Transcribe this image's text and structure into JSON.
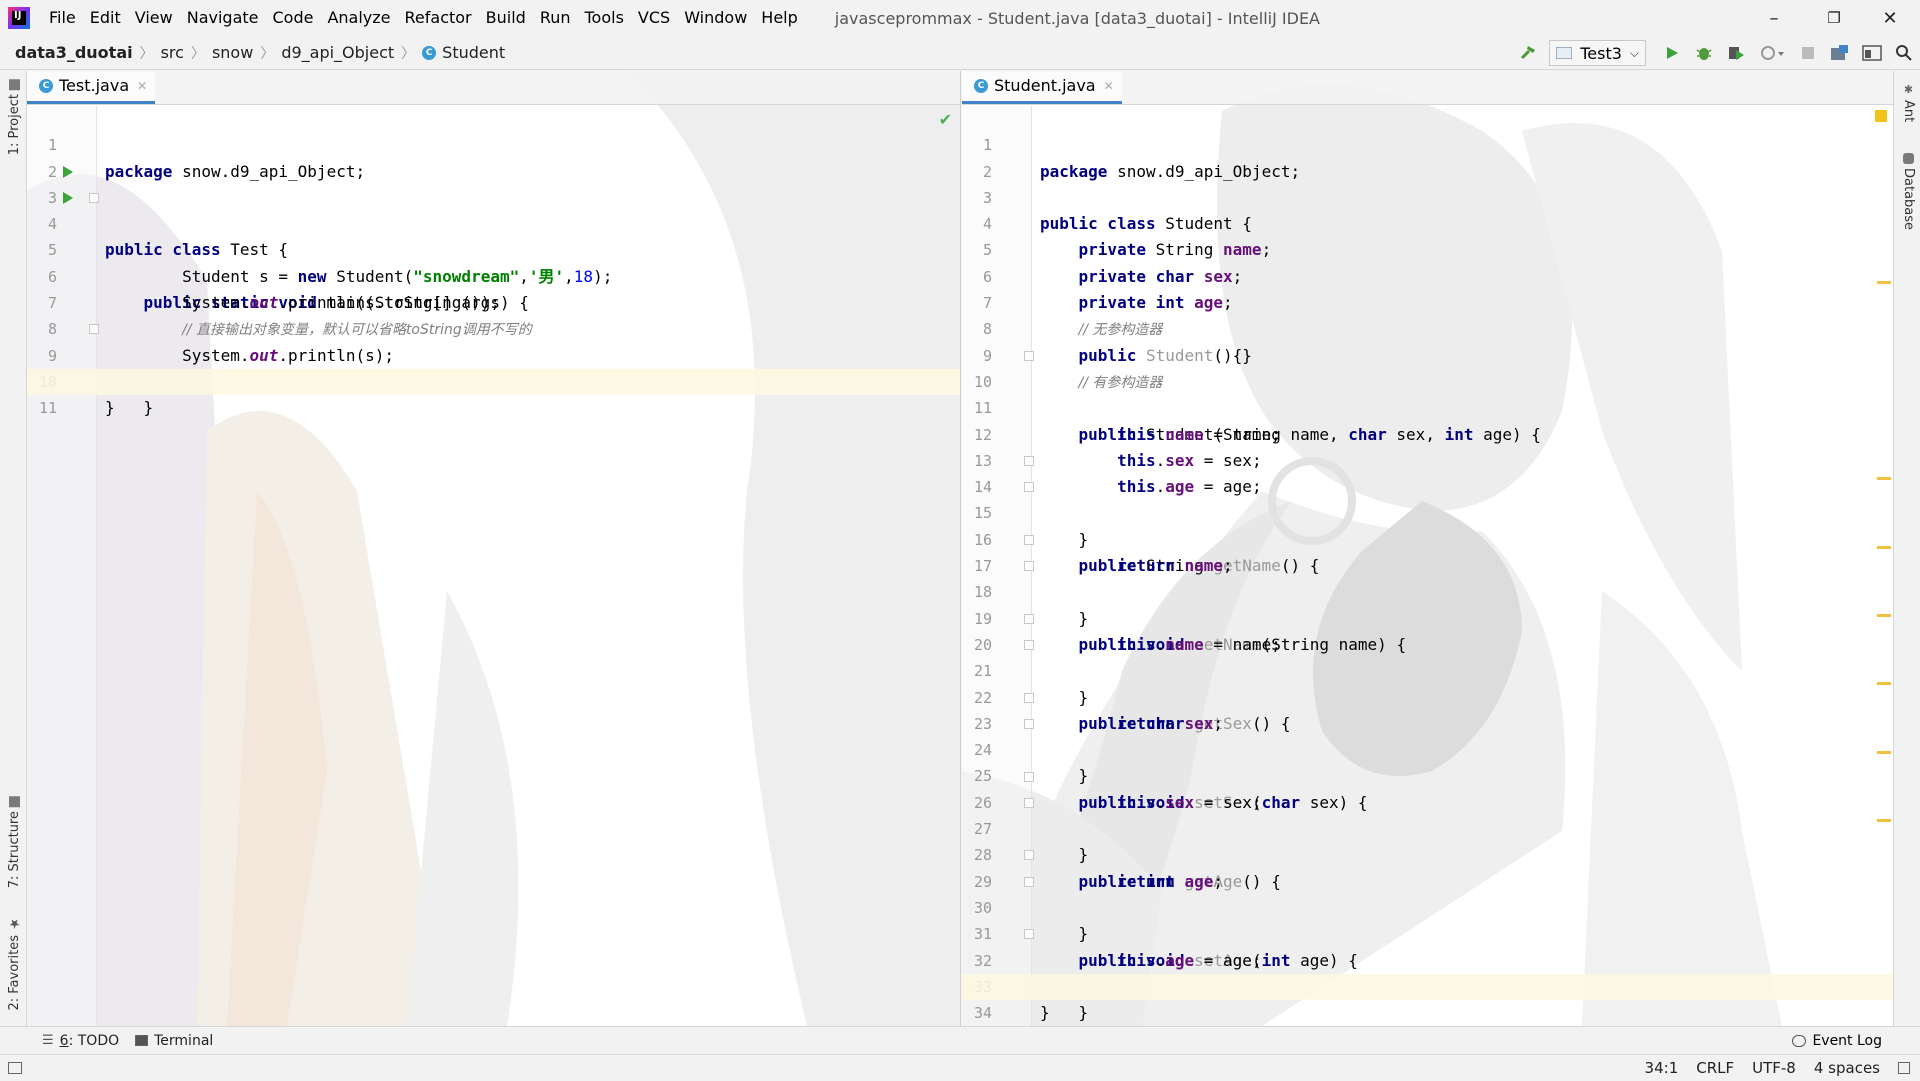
{
  "window": {
    "title": "javasceprommax - Student.java [data3_duotai] - IntelliJ IDEA",
    "controls": {
      "minimize": "–",
      "restore": "❐",
      "close": "✕"
    }
  },
  "menu": [
    {
      "label": "File"
    },
    {
      "label": "Edit"
    },
    {
      "label": "View"
    },
    {
      "label": "Navigate"
    },
    {
      "label": "Code"
    },
    {
      "label": "Analyze"
    },
    {
      "label": "Refactor"
    },
    {
      "label": "Build"
    },
    {
      "label": "Run"
    },
    {
      "label": "Tools"
    },
    {
      "label": "VCS"
    },
    {
      "label": "Window"
    },
    {
      "label": "Help"
    }
  ],
  "breadcrumb": [
    "data3_duotai",
    "src",
    "snow",
    "d9_api_Object",
    "Student"
  ],
  "run_config": {
    "label": "Test3"
  },
  "icons": {
    "hammer": "hammer-icon",
    "run": "run-icon",
    "debug": "debug-icon",
    "coverage": "coverage-icon",
    "profile": "profile-icon",
    "stop": "stop-icon",
    "project_structure": "project-structure-icon",
    "layout": "layout-icon",
    "search": "search-icon"
  },
  "left_strip": {
    "project": "1: Project",
    "structure": "7: Structure",
    "favorites": "2: Favorites"
  },
  "right_strip": {
    "ant": "Ant",
    "database": "Database"
  },
  "editor_left": {
    "tab": "Test.java",
    "lines": [
      {
        "n": "1"
      },
      {
        "n": "2"
      },
      {
        "n": "3"
      },
      {
        "n": "4"
      },
      {
        "n": "5"
      },
      {
        "n": "6"
      },
      {
        "n": "7"
      },
      {
        "n": "8"
      },
      {
        "n": "9"
      },
      {
        "n": "10"
      },
      {
        "n": "11"
      }
    ],
    "code": {
      "l1_kw": "package",
      "l1_rest": " snow.d9_api_Object;",
      "l3_kw": "public class",
      "l3_rest": " Test {",
      "l4_kw": "public static void",
      "l4_rest": " main(String[] args) {",
      "l5_a": "Student s = ",
      "l5_kw": "new",
      "l5_b": " Student(",
      "l5_str": "\"snowdream\"",
      "l5_c": ",",
      "l5_char": "'男'",
      "l5_d": ",",
      "l5_num": "18",
      "l5_e": ");",
      "l6_a": "System.",
      "l6_out": "out",
      "l6_b": ".println(s.toString());",
      "l7": "// 直接输出对象变量，默认可以省略toString调用不写的",
      "l8_a": "System.",
      "l8_out": "out",
      "l8_b": ".println(s);",
      "l9": "}",
      "l10": "}"
    }
  },
  "editor_right": {
    "tab": "Student.java",
    "lines": [
      {
        "n": "1"
      },
      {
        "n": "2"
      },
      {
        "n": "3"
      },
      {
        "n": "4"
      },
      {
        "n": "5"
      },
      {
        "n": "6"
      },
      {
        "n": "7"
      },
      {
        "n": "8"
      },
      {
        "n": "9"
      },
      {
        "n": "10"
      },
      {
        "n": "11"
      },
      {
        "n": "12"
      },
      {
        "n": "13"
      },
      {
        "n": "14"
      },
      {
        "n": "15"
      },
      {
        "n": "16"
      },
      {
        "n": "17"
      },
      {
        "n": "18"
      },
      {
        "n": "19"
      },
      {
        "n": "20"
      },
      {
        "n": "21"
      },
      {
        "n": "22"
      },
      {
        "n": "23"
      },
      {
        "n": "24"
      },
      {
        "n": "25"
      },
      {
        "n": "26"
      },
      {
        "n": "27"
      },
      {
        "n": "28"
      },
      {
        "n": "29"
      },
      {
        "n": "30"
      },
      {
        "n": "31"
      },
      {
        "n": "32"
      },
      {
        "n": "33"
      },
      {
        "n": "34"
      }
    ],
    "code": {
      "l1_kw": "package",
      "l1_rest": " snow.d9_api_Object;",
      "l3_kw": "public class",
      "l3_rest": " Student {",
      "l4_kw": "private",
      "l4_a": " String ",
      "l4_f": "name",
      "l4_b": ";",
      "l5_kw": "private char",
      "l5_a": " ",
      "l5_f": "sex",
      "l5_b": ";",
      "l6_kw": "private int",
      "l6_a": " ",
      "l6_f": "age",
      "l6_b": ";",
      "l7": "// 无参构造器",
      "l8_kw": "public",
      "l8_a": " ",
      "l8_u": "Student",
      "l8_b": "(){}",
      "l9": "// 有参构造器",
      "l10_kw": "public",
      "l10_a": " Student(String name, ",
      "l10_kw2": "char",
      "l10_b": " sex, ",
      "l10_kw3": "int",
      "l10_c": " age) {",
      "l11_kw": "this",
      "l11_a": ".",
      "l11_f": "name",
      "l11_b": " = name;",
      "l12_kw": "this",
      "l12_a": ".",
      "l12_f": "sex",
      "l12_b": " = sex;",
      "l13_kw": "this",
      "l13_a": ".",
      "l13_f": "age",
      "l13_b": " = age;",
      "l14": "}",
      "l15_kw": "public",
      "l15_a": " String ",
      "l15_u": "getName",
      "l15_b": "() {",
      "l16_kw": "return",
      "l16_a": " ",
      "l16_f": "name",
      "l16_b": ";",
      "l17": "}",
      "l18_kw": "public void",
      "l18_a": " ",
      "l18_u": "setName",
      "l18_b": "(String name) {",
      "l19_kw": "this",
      "l19_a": ".",
      "l19_f": "name",
      "l19_b": " = name;",
      "l20": "}",
      "l21_kw": "public char",
      "l21_a": " ",
      "l21_u": "getSex",
      "l21_b": "() {",
      "l22_kw": "return",
      "l22_a": " ",
      "l22_f": "sex",
      "l22_b": ";",
      "l23": "}",
      "l24_kw": "public void",
      "l24_a": " ",
      "l24_u": "setSex",
      "l24_b": "(",
      "l24_kw2": "char",
      "l24_c": " sex) {",
      "l25_kw": "this",
      "l25_a": ".",
      "l25_f": "sex",
      "l25_b": " = sex;",
      "l26": "}",
      "l27_kw": "public int",
      "l27_a": " ",
      "l27_u": "getAge",
      "l27_b": "() {",
      "l28_kw": "return",
      "l28_a": " ",
      "l28_f": "age",
      "l28_b": ";",
      "l29": "}",
      "l30_kw": "public void",
      "l30_a": " ",
      "l30_u": "setAge",
      "l30_b": "(",
      "l30_kw2": "int",
      "l30_c": " age) {",
      "l31_kw": "this",
      "l31_a": ".",
      "l31_f": "age",
      "l31_b": " = age;",
      "l32": "}",
      "l33": "}"
    }
  },
  "bottom_tools": {
    "todo_num": "6",
    "todo": ": TODO",
    "terminal": "Terminal",
    "event_log": "Event Log"
  },
  "status": {
    "position": "34:1",
    "line_sep": "CRLF",
    "encoding": "UTF-8",
    "indent": "4 spaces"
  },
  "colors": {
    "keyword": "#000080",
    "field": "#660e7a",
    "string": "#008000",
    "number": "#0000ff",
    "comment": "#808080",
    "current_line": "#fcf8e1"
  }
}
